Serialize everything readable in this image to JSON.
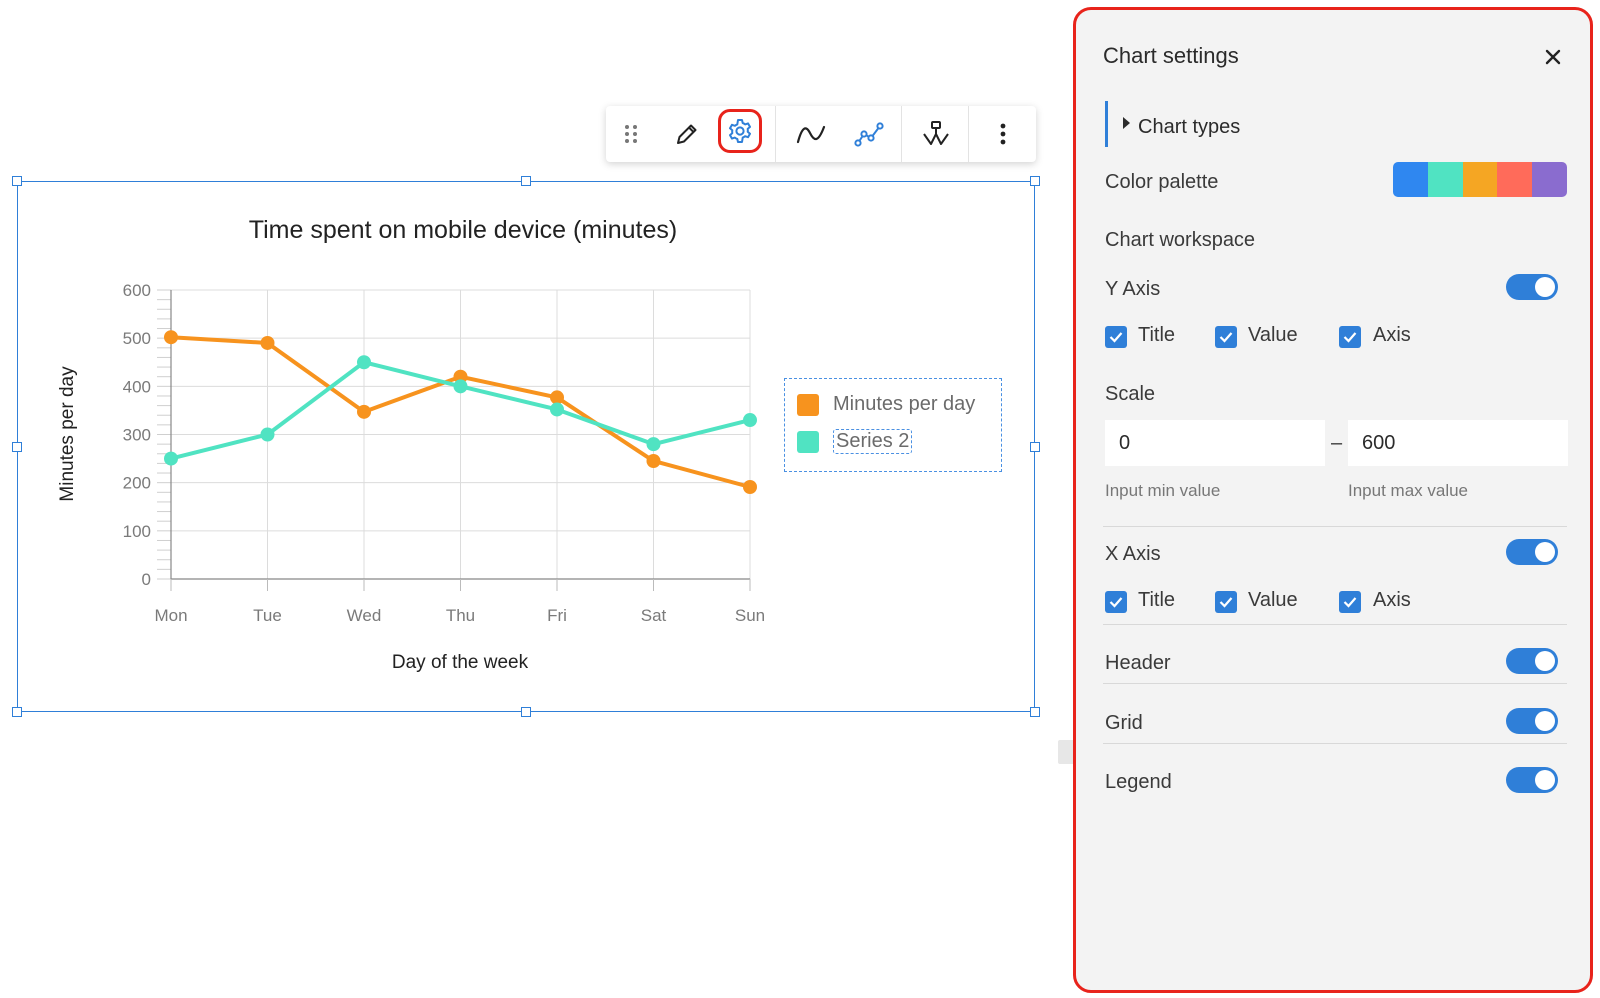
{
  "toolbar": {
    "items": [
      "drag-handle",
      "edit",
      "settings",
      "smooth-line",
      "line-with-markers",
      "chart-style",
      "more"
    ],
    "active": "settings"
  },
  "chart_data": {
    "type": "line",
    "title": "Time spent on mobile device (minutes)",
    "xlabel": "Day of the week",
    "ylabel": "Minutes per day",
    "categories": [
      "Mon",
      "Tue",
      "Wed",
      "Thu",
      "Fri",
      "Sat",
      "Sun"
    ],
    "y_ticks": [
      "0",
      "100",
      "200",
      "300",
      "400",
      "500",
      "600"
    ],
    "ylim": [
      0,
      600
    ],
    "grid": true,
    "legend_position": "right",
    "series": [
      {
        "name": "Minutes per day",
        "color": "#f7931e",
        "values": [
          502,
          490,
          347,
          420,
          377,
          245,
          191
        ]
      },
      {
        "name": "Series 2",
        "color": "#50e3c2",
        "values": [
          250,
          300,
          450,
          400,
          352,
          280,
          330
        ]
      }
    ]
  },
  "settings": {
    "title": "Chart settings",
    "chart_types_label": "Chart types",
    "color_palette_label": "Color palette",
    "palette_colors": [
      "#2f87f0",
      "#50e3c2",
      "#f5a623",
      "#ff6b5a",
      "#8a6ccf"
    ],
    "workspace_label": "Chart workspace",
    "y_axis": {
      "label": "Y Axis",
      "enabled": true,
      "options": [
        {
          "label": "Title",
          "checked": true
        },
        {
          "label": "Value",
          "checked": true
        },
        {
          "label": "Axis",
          "checked": true
        }
      ]
    },
    "scale": {
      "label": "Scale",
      "min_value": "0",
      "max_value": "600",
      "separator": "–",
      "min_hint": "Input min value",
      "max_hint": "Input max value"
    },
    "x_axis": {
      "label": "X Axis",
      "enabled": true,
      "options": [
        {
          "label": "Title",
          "checked": true
        },
        {
          "label": "Value",
          "checked": true
        },
        {
          "label": "Axis",
          "checked": true
        }
      ]
    },
    "header": {
      "label": "Header",
      "enabled": true
    },
    "grid": {
      "label": "Grid",
      "enabled": true
    },
    "legend": {
      "label": "Legend",
      "enabled": true
    }
  }
}
